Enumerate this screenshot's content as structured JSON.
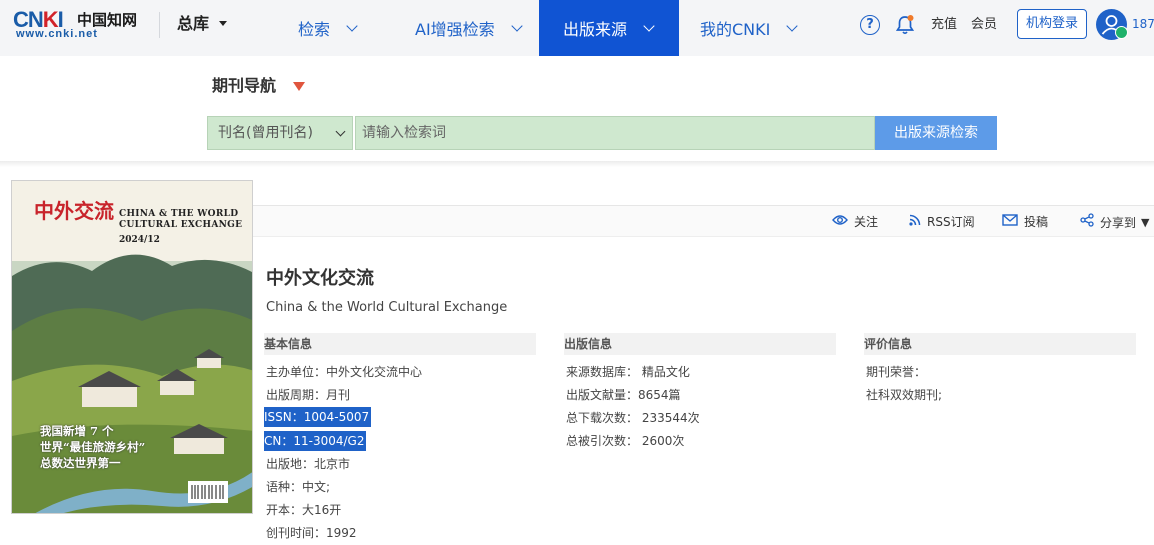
{
  "logo": {
    "brand": "CNKI",
    "chinese": "中国知网",
    "url": "www.cnki.net"
  },
  "topnav": {
    "database": "总库",
    "items": [
      {
        "label": "检索"
      },
      {
        "label": "AI增强检索"
      },
      {
        "label": "出版来源",
        "active": true
      },
      {
        "label": "我的CNKI"
      }
    ],
    "recharge": "充值",
    "member": "会员",
    "login": "机构登录",
    "user_id": "187"
  },
  "search": {
    "section_title": "期刊导航",
    "field": "刊名(曾用刊名)",
    "placeholder": "请输入检索词",
    "button": "出版来源检索"
  },
  "tools": {
    "follow": "关注",
    "rss": "RSS订阅",
    "submit": "投稿",
    "share": "分享到"
  },
  "cover": {
    "cn_title": "中外交流",
    "en_title_1": "CHINA & THE WORLD",
    "en_title_2": "CULTURAL EXCHANGE",
    "issue": "2024/12",
    "caption_1": "我国新增 7 个",
    "caption_2": "世界“最佳旅游乡村”",
    "caption_3": "总数达世界第一"
  },
  "journal": {
    "title": "中外文化交流",
    "en_title": "China & the World Cultural Exchange",
    "basic": {
      "heading": "基本信息",
      "sponsor": "主办单位：中外文化交流中心",
      "frequency": "出版周期：月刊",
      "issn": "ISSN：1004-5007",
      "cn": "CN：11-3004/G2",
      "location": "出版地：北京市",
      "language": "语种：中文;",
      "format": "开本：大16开",
      "founded": "创刊时间：1992"
    },
    "publishing": {
      "heading": "出版信息",
      "source_db": "来源数据库：  精品文化",
      "articles": "出版文献量：8654篇",
      "downloads": "总下载次数：  233544次",
      "citations": "总被引次数：  2600次"
    },
    "evaluation": {
      "heading": "评价信息",
      "honors": "期刊荣誉：",
      "honor_value": "社科双效期刊;"
    }
  },
  "colors": {
    "accent": "#1f62c8",
    "active_nav": "#1054d3",
    "search_bg": "#cfe8cf",
    "search_btn": "#5d9be8"
  }
}
